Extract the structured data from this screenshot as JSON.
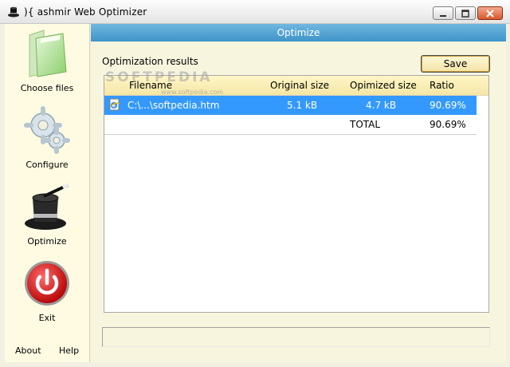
{
  "window": {
    "title": "){ ashmir Web Optimizer"
  },
  "sidebar": {
    "items": [
      {
        "label": "Choose files",
        "icon": "folder-icon"
      },
      {
        "label": "Configure",
        "icon": "gears-icon"
      },
      {
        "label": "Optimize",
        "icon": "magic-hat-icon"
      },
      {
        "label": "Exit",
        "icon": "power-icon"
      }
    ],
    "about": "About",
    "help": "Help"
  },
  "header": {
    "title": "Optimize"
  },
  "results": {
    "label": "Optimization results",
    "save_label": "Save",
    "columns": [
      "Filename",
      "Original size",
      "Opimized size",
      "Ratio"
    ],
    "rows": [
      {
        "filename": "C:\\...\\softpedia.htm",
        "original": "5.1 kB",
        "optimized": "4.7 kB",
        "ratio": "90.69%",
        "selected": true
      }
    ],
    "total": {
      "label": "TOTAL",
      "ratio": "90.69%"
    }
  },
  "watermark": {
    "text": "SOFTPEDIA",
    "url": "www.softpedia.com"
  },
  "colors": {
    "header": "#4a9fd2",
    "selection": "#3399ff",
    "sidebar": "#fffbe3",
    "table_header": "#f8ebb0"
  }
}
